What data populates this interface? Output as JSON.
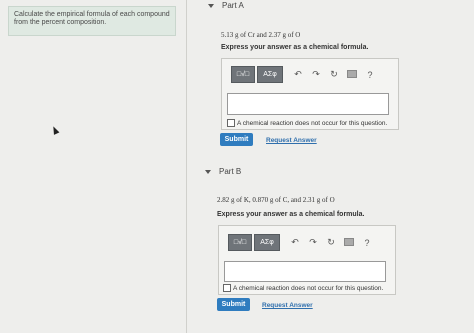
{
  "instructions": {
    "text": "Calculate the empirical formula of each compound from the percent composition."
  },
  "partA": {
    "label": "Part A",
    "question": "5.13 g of Cr and 2.37 g of O",
    "prompt": "Express your answer as a chemical formula.",
    "toolbar": {
      "template_label": "□√□",
      "greek_label": "ΑΣφ",
      "undo_icon": "undo-arrow",
      "redo_icon": "redo-arrow",
      "reset_icon": "reset-circle",
      "keyboard_icon": "keyboard",
      "help_label": "?"
    },
    "input_value": "",
    "checkbox_label": "A chemical reaction does not occur for this question.",
    "submit_label": "Submit",
    "request_label": "Request Answer"
  },
  "partB": {
    "label": "Part B",
    "question": "2.82 g of K, 0.870 g of C, and 2.31 g of O",
    "prompt": "Express your answer as a chemical formula.",
    "toolbar": {
      "template_label": "□√□",
      "greek_label": "ΑΣφ",
      "undo_icon": "undo-arrow",
      "redo_icon": "redo-arrow",
      "reset_icon": "reset-circle",
      "keyboard_icon": "keyboard",
      "help_label": "?"
    },
    "input_value": "",
    "checkbox_label": "A chemical reaction does not occur for this question.",
    "submit_label": "Submit",
    "request_label": "Request Answer"
  }
}
